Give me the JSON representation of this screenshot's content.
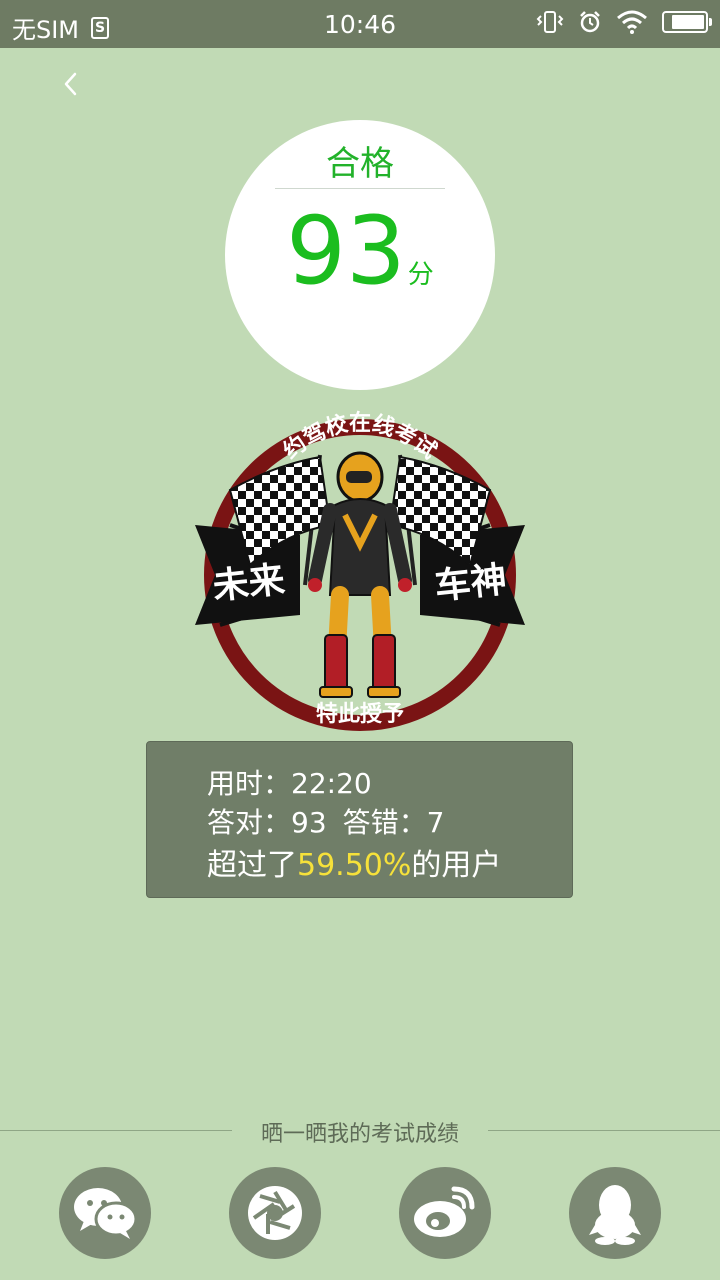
{
  "status_bar": {
    "carrier": "无SIM",
    "sim_icon_glyph": "S",
    "time": "10:46",
    "battery_level": 0.85,
    "icons": [
      "sim-card-icon",
      "vibrate-icon",
      "alarm-icon",
      "wifi-icon",
      "battery-icon"
    ]
  },
  "nav": {
    "back_icon": "chevron-left-icon"
  },
  "score_card": {
    "result": "合格",
    "score": "93",
    "unit": "分",
    "result_color": "#22b22a"
  },
  "badge": {
    "top_text": "约驾校在线考试",
    "left_text": "未来",
    "right_text": "车神",
    "bottom_text": "特此授予",
    "ring_color": "#7a1414"
  },
  "stats": {
    "time_label": "用时：",
    "time_value": "22:20",
    "correct_label": "答对：",
    "correct_value": "93",
    "wrong_label": "答错：",
    "wrong_value": "7",
    "exceed_prefix": "超过了",
    "exceed_percent": "59.50%",
    "exceed_suffix": "的用户",
    "highlight_color": "#f6e13a"
  },
  "share": {
    "title": "晒一晒我的考试成绩",
    "buttons": [
      {
        "name": "wechat",
        "icon": "wechat-icon"
      },
      {
        "name": "moments",
        "icon": "aperture-icon"
      },
      {
        "name": "weibo",
        "icon": "weibo-icon"
      },
      {
        "name": "qq",
        "icon": "qq-penguin-icon"
      }
    ]
  }
}
